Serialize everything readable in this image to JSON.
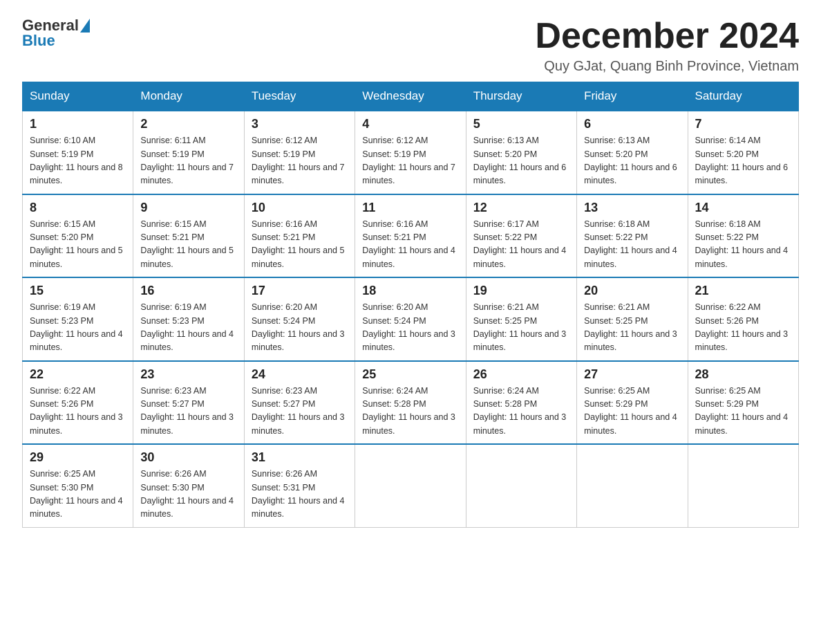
{
  "logo": {
    "general": "General",
    "blue": "Blue"
  },
  "title": "December 2024",
  "location": "Quy GJat, Quang Binh Province, Vietnam",
  "days_of_week": [
    "Sunday",
    "Monday",
    "Tuesday",
    "Wednesday",
    "Thursday",
    "Friday",
    "Saturday"
  ],
  "weeks": [
    [
      {
        "day": "1",
        "sunrise": "6:10 AM",
        "sunset": "5:19 PM",
        "daylight": "11 hours and 8 minutes."
      },
      {
        "day": "2",
        "sunrise": "6:11 AM",
        "sunset": "5:19 PM",
        "daylight": "11 hours and 7 minutes."
      },
      {
        "day": "3",
        "sunrise": "6:12 AM",
        "sunset": "5:19 PM",
        "daylight": "11 hours and 7 minutes."
      },
      {
        "day": "4",
        "sunrise": "6:12 AM",
        "sunset": "5:19 PM",
        "daylight": "11 hours and 7 minutes."
      },
      {
        "day": "5",
        "sunrise": "6:13 AM",
        "sunset": "5:20 PM",
        "daylight": "11 hours and 6 minutes."
      },
      {
        "day": "6",
        "sunrise": "6:13 AM",
        "sunset": "5:20 PM",
        "daylight": "11 hours and 6 minutes."
      },
      {
        "day": "7",
        "sunrise": "6:14 AM",
        "sunset": "5:20 PM",
        "daylight": "11 hours and 6 minutes."
      }
    ],
    [
      {
        "day": "8",
        "sunrise": "6:15 AM",
        "sunset": "5:20 PM",
        "daylight": "11 hours and 5 minutes."
      },
      {
        "day": "9",
        "sunrise": "6:15 AM",
        "sunset": "5:21 PM",
        "daylight": "11 hours and 5 minutes."
      },
      {
        "day": "10",
        "sunrise": "6:16 AM",
        "sunset": "5:21 PM",
        "daylight": "11 hours and 5 minutes."
      },
      {
        "day": "11",
        "sunrise": "6:16 AM",
        "sunset": "5:21 PM",
        "daylight": "11 hours and 4 minutes."
      },
      {
        "day": "12",
        "sunrise": "6:17 AM",
        "sunset": "5:22 PM",
        "daylight": "11 hours and 4 minutes."
      },
      {
        "day": "13",
        "sunrise": "6:18 AM",
        "sunset": "5:22 PM",
        "daylight": "11 hours and 4 minutes."
      },
      {
        "day": "14",
        "sunrise": "6:18 AM",
        "sunset": "5:22 PM",
        "daylight": "11 hours and 4 minutes."
      }
    ],
    [
      {
        "day": "15",
        "sunrise": "6:19 AM",
        "sunset": "5:23 PM",
        "daylight": "11 hours and 4 minutes."
      },
      {
        "day": "16",
        "sunrise": "6:19 AM",
        "sunset": "5:23 PM",
        "daylight": "11 hours and 4 minutes."
      },
      {
        "day": "17",
        "sunrise": "6:20 AM",
        "sunset": "5:24 PM",
        "daylight": "11 hours and 3 minutes."
      },
      {
        "day": "18",
        "sunrise": "6:20 AM",
        "sunset": "5:24 PM",
        "daylight": "11 hours and 3 minutes."
      },
      {
        "day": "19",
        "sunrise": "6:21 AM",
        "sunset": "5:25 PM",
        "daylight": "11 hours and 3 minutes."
      },
      {
        "day": "20",
        "sunrise": "6:21 AM",
        "sunset": "5:25 PM",
        "daylight": "11 hours and 3 minutes."
      },
      {
        "day": "21",
        "sunrise": "6:22 AM",
        "sunset": "5:26 PM",
        "daylight": "11 hours and 3 minutes."
      }
    ],
    [
      {
        "day": "22",
        "sunrise": "6:22 AM",
        "sunset": "5:26 PM",
        "daylight": "11 hours and 3 minutes."
      },
      {
        "day": "23",
        "sunrise": "6:23 AM",
        "sunset": "5:27 PM",
        "daylight": "11 hours and 3 minutes."
      },
      {
        "day": "24",
        "sunrise": "6:23 AM",
        "sunset": "5:27 PM",
        "daylight": "11 hours and 3 minutes."
      },
      {
        "day": "25",
        "sunrise": "6:24 AM",
        "sunset": "5:28 PM",
        "daylight": "11 hours and 3 minutes."
      },
      {
        "day": "26",
        "sunrise": "6:24 AM",
        "sunset": "5:28 PM",
        "daylight": "11 hours and 3 minutes."
      },
      {
        "day": "27",
        "sunrise": "6:25 AM",
        "sunset": "5:29 PM",
        "daylight": "11 hours and 4 minutes."
      },
      {
        "day": "28",
        "sunrise": "6:25 AM",
        "sunset": "5:29 PM",
        "daylight": "11 hours and 4 minutes."
      }
    ],
    [
      {
        "day": "29",
        "sunrise": "6:25 AM",
        "sunset": "5:30 PM",
        "daylight": "11 hours and 4 minutes."
      },
      {
        "day": "30",
        "sunrise": "6:26 AM",
        "sunset": "5:30 PM",
        "daylight": "11 hours and 4 minutes."
      },
      {
        "day": "31",
        "sunrise": "6:26 AM",
        "sunset": "5:31 PM",
        "daylight": "11 hours and 4 minutes."
      },
      null,
      null,
      null,
      null
    ]
  ]
}
